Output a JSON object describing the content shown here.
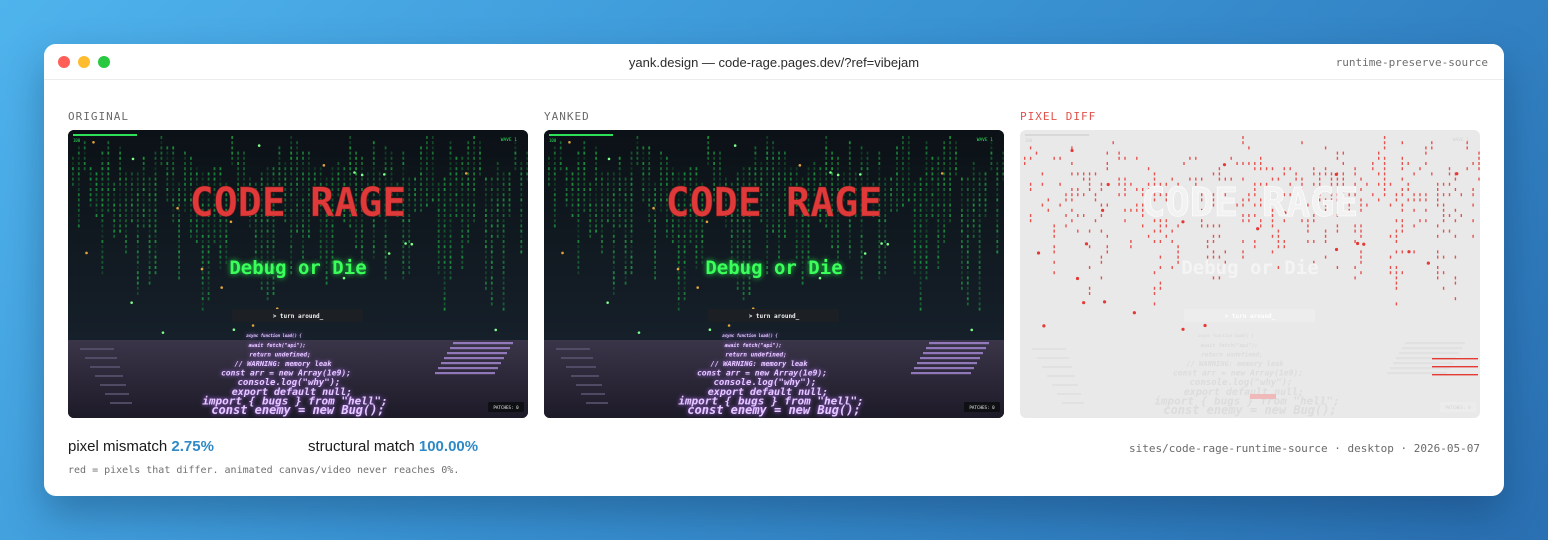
{
  "window": {
    "title": "yank.design — code-rage.pages.dev/?ref=vibejam",
    "mode_label": "runtime-preserve-source",
    "traffic_lights": [
      "#ff5f57",
      "#febc2e",
      "#28c840"
    ]
  },
  "panels": [
    {
      "label": "ORIGINAL",
      "variant": "normal"
    },
    {
      "label": "YANKED",
      "variant": "normal"
    },
    {
      "label": "PIXEL DIFF",
      "variant": "diff"
    }
  ],
  "game": {
    "title": "CODE RAGE",
    "subtitle": "Debug or Die",
    "prompt": "> turn around_",
    "wave": "WAVE 1",
    "health": "100",
    "patches": "PATCHES: 0",
    "code_lines": [
      "const enemy = new Bug();",
      "import { bugs } from \"hell\";",
      "export default null;",
      "console.log(\"why\");",
      "const arr = new Array(1e9);",
      "// WARNING: memory leak",
      "return undefined;",
      "await fetch(\"api\");",
      "async function load() {"
    ],
    "colors": {
      "title": "#e0393a",
      "subtitle": "#3bff5a",
      "rain": "#22c24a",
      "code": "#e6c9ff"
    }
  },
  "stats": {
    "mismatch_label": "pixel mismatch",
    "mismatch_value": "2.75%",
    "structural_label": "structural match",
    "structural_value": "100.00%",
    "note": "red = pixels that differ. animated canvas/video never reaches 0%.",
    "meta": "sites/code-rage-runtime-source · desktop · 2026-05-07"
  }
}
